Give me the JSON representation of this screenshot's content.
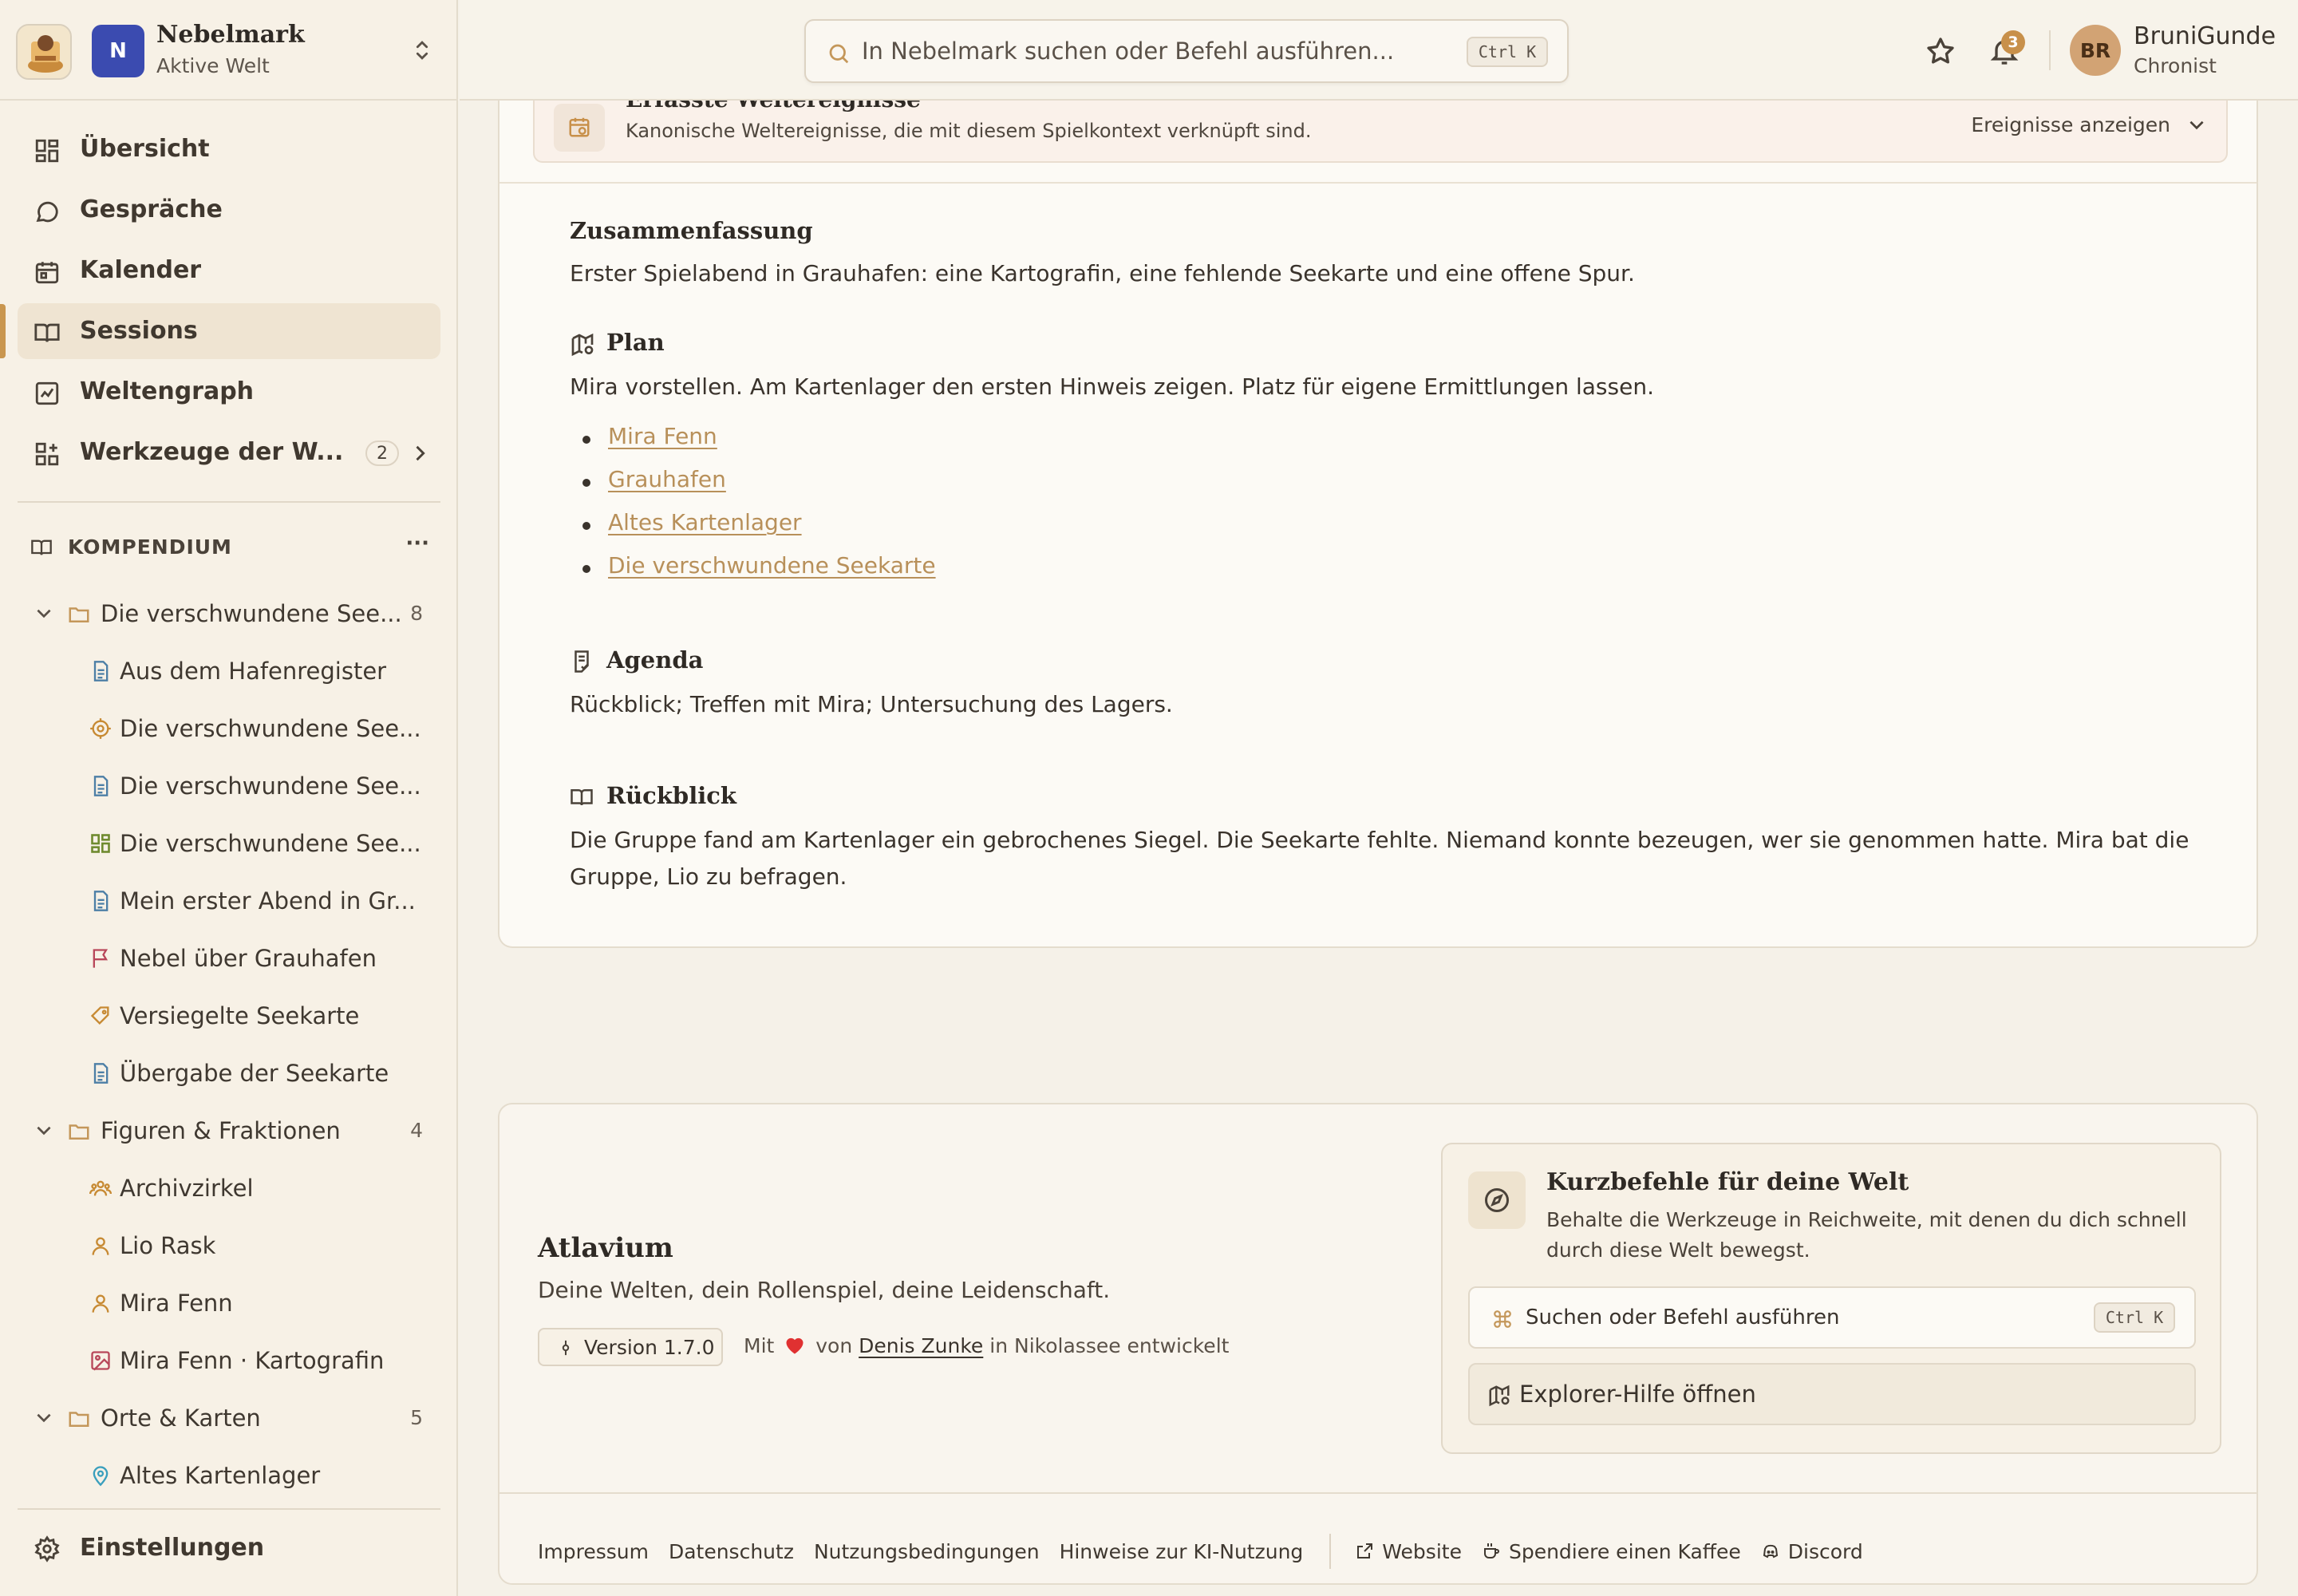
{
  "workspace": {
    "initial": "N",
    "name": "Nebelmark",
    "subtitle": "Aktive Welt"
  },
  "nav": [
    {
      "label": "Übersicht",
      "icon": "grid-icon"
    },
    {
      "label": "Gespräche",
      "icon": "chat-icon"
    },
    {
      "label": "Kalender",
      "icon": "calendar-icon"
    },
    {
      "label": "Sessions",
      "icon": "book-icon",
      "active": true
    },
    {
      "label": "Weltengraph",
      "icon": "chart-icon"
    },
    {
      "label": "Werkzeuge der W...",
      "icon": "tools-icon",
      "count": "2"
    }
  ],
  "compendium": {
    "title": "KOMPENDIUM",
    "more": "···",
    "folders": [
      {
        "label": "Die verschwundene See...",
        "count": "8",
        "items": [
          {
            "label": "Aus dem Hafenregister",
            "icon": "document-icon"
          },
          {
            "label": "Die verschwundene See...",
            "icon": "target-icon"
          },
          {
            "label": "Die verschwundene See...",
            "icon": "document-icon"
          },
          {
            "label": "Die verschwundene See...",
            "icon": "grid-icon"
          },
          {
            "label": "Mein erster Abend in Gr...",
            "icon": "document-icon"
          },
          {
            "label": "Nebel über Grauhafen",
            "icon": "flag-icon"
          },
          {
            "label": "Versiegelte Seekarte",
            "icon": "gem-icon"
          },
          {
            "label": "Übergabe der Seekarte",
            "icon": "document-icon"
          }
        ]
      },
      {
        "label": "Figuren & Fraktionen",
        "count": "4",
        "items": [
          {
            "label": "Archivzirkel",
            "icon": "group-icon"
          },
          {
            "label": "Lio Rask",
            "icon": "person-icon"
          },
          {
            "label": "Mira Fenn",
            "icon": "person-icon"
          },
          {
            "label": "Mira Fenn · Kartografin",
            "icon": "image-icon"
          }
        ]
      },
      {
        "label": "Orte & Karten",
        "count": "5",
        "items": [
          {
            "label": "Altes Kartenlager",
            "icon": "pin-icon"
          }
        ]
      }
    ]
  },
  "settings_label": "Einstellungen",
  "search": {
    "placeholder": "In Nebelmark suchen oder Befehl ausführen...",
    "shortcut": "Ctrl K"
  },
  "notifications_count": "3",
  "user": {
    "initials": "BR",
    "name": "BruniGunde",
    "role": "Chronist"
  },
  "events_panel": {
    "title": "Erfasste Weltereignisse",
    "subtitle": "Kanonische Weltereignisse, die mit diesem Spielkontext verknüpft sind.",
    "button": "Ereignisse anzeigen"
  },
  "session": {
    "summary_heading": "Zusammenfassung",
    "summary_text": "Erster Spielabend in Grauhafen: eine Kartografin, eine fehlende Seekarte und eine offene Spur.",
    "plan_heading": "Plan",
    "plan_text": "Mira vorstellen. Am Kartenlager den ersten Hinweis zeigen. Platz für eigene Ermittlungen lassen.",
    "plan_links": [
      "Mira Fenn",
      "Grauhafen",
      "Altes Kartenlager",
      "Die verschwundene Seekarte"
    ],
    "agenda_heading": "Agenda",
    "agenda_text": "Rückblick; Treffen mit Mira; Untersuchung des Lagers.",
    "recap_heading": "Rückblick",
    "recap_line1": "Die Gruppe fand am Kartenlager ein gebrochenes Siegel. Die Seekarte fehlte. Niemand konnte bezeugen, wer sie genommen hatte. Mira bat die",
    "recap_line2": "Gruppe, Lio zu befragen."
  },
  "footer": {
    "brand": "Atlavium",
    "tagline": "Deine Welten, dein Rollenspiel, deine Leidenschaft.",
    "version": "Version 1.7.0",
    "made_prefix": "Mit",
    "made_by": "von",
    "author": "Denis Zunke",
    "made_suffix": "in Nikolassee entwickelt",
    "shortcuts": {
      "title": "Kurzbefehle für deine Welt",
      "subtitle": "Behalte die Werkzeuge in Reichweite, mit denen du dich schnell durch diese Welt bewegst.",
      "search_label": "Suchen oder Befehl ausführen",
      "search_shortcut": "Ctrl K",
      "help_label": "Explorer-Hilfe öffnen"
    },
    "links": [
      "Impressum",
      "Datenschutz",
      "Nutzungsbedingungen",
      "Hinweise zur KI-Nutzung"
    ],
    "external_links": [
      "Website",
      "Spendiere einen Kaffee",
      "Discord"
    ]
  },
  "colors": {
    "accent": "#c9964f",
    "link": "#b8905a",
    "workspace_badge": "#3b4bb0",
    "avatar": "#d2a374",
    "heart": "#e03131"
  }
}
